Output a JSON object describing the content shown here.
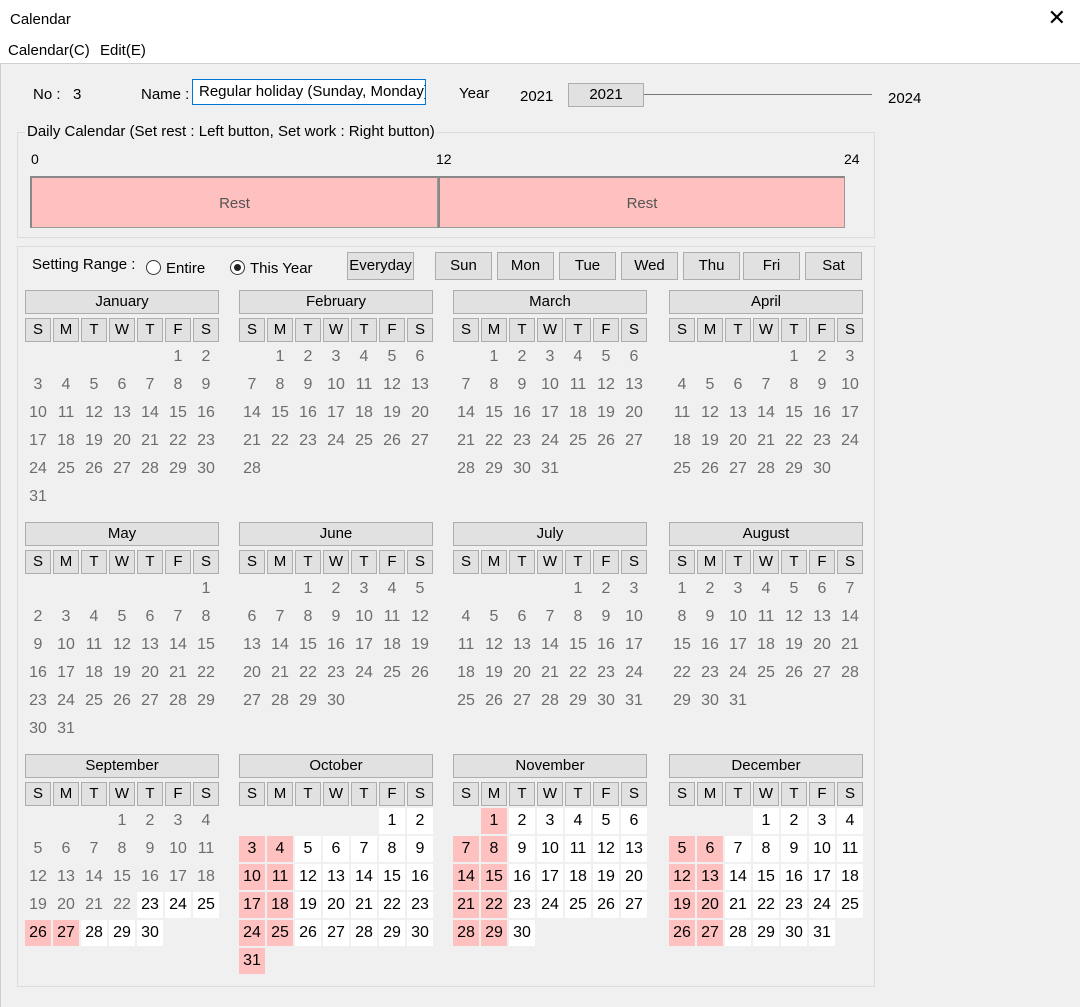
{
  "window": {
    "title": "Calendar"
  },
  "menu": {
    "calendar": "Calendar(C)",
    "edit": "Edit(E)"
  },
  "header": {
    "no_label": "No :",
    "no_value": "3",
    "name_label": "Name :",
    "name_value": "Regular holiday (Sunday, Monday)",
    "year_label": "Year",
    "year_min": "2021",
    "year_button": "2021",
    "year_max": "2024"
  },
  "daily": {
    "caption": "Daily Calendar (Set rest : Left button,  Set work : Right button)",
    "tick_0": "0",
    "tick_12": "12",
    "tick_24": "24",
    "block1": "Rest",
    "block2": "Rest"
  },
  "range": {
    "label": "Setting Range :",
    "entire": "Entire",
    "this_year": "This Year",
    "selected": "this_year"
  },
  "buttons": {
    "everyday": "Everyday",
    "weekdays": [
      "Sun",
      "Mon",
      "Tue",
      "Wed",
      "Thu",
      "Fri",
      "Sat"
    ]
  },
  "weekday_headers": [
    "S",
    "M",
    "T",
    "W",
    "T",
    "F",
    "S"
  ],
  "colors": {
    "rest": "#ffc0c0",
    "work": "#ffffff",
    "past": "#6d6d6d"
  },
  "calendar": {
    "year": 2021,
    "today": "2021-09-23",
    "rest_weekdays": [
      "Sun",
      "Mon"
    ],
    "months": [
      "January",
      "February",
      "March",
      "April",
      "May",
      "June",
      "July",
      "August",
      "September",
      "October",
      "November",
      "December"
    ]
  }
}
